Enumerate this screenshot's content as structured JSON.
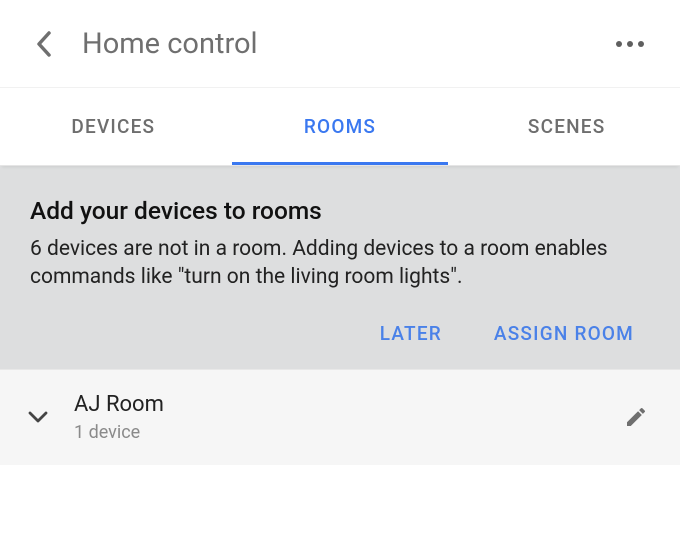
{
  "header": {
    "title": "Home control"
  },
  "tabs": {
    "devices": "DEVICES",
    "rooms": "ROOMS",
    "scenes": "SCENES"
  },
  "banner": {
    "title": "Add your devices to rooms",
    "text": "6 devices are not in a room. Adding devices to a room enables commands like \"turn on the living room lights\".",
    "later": "LATER",
    "assign": "ASSIGN ROOM"
  },
  "room": {
    "name": "AJ Room",
    "subtitle": "1 device"
  }
}
